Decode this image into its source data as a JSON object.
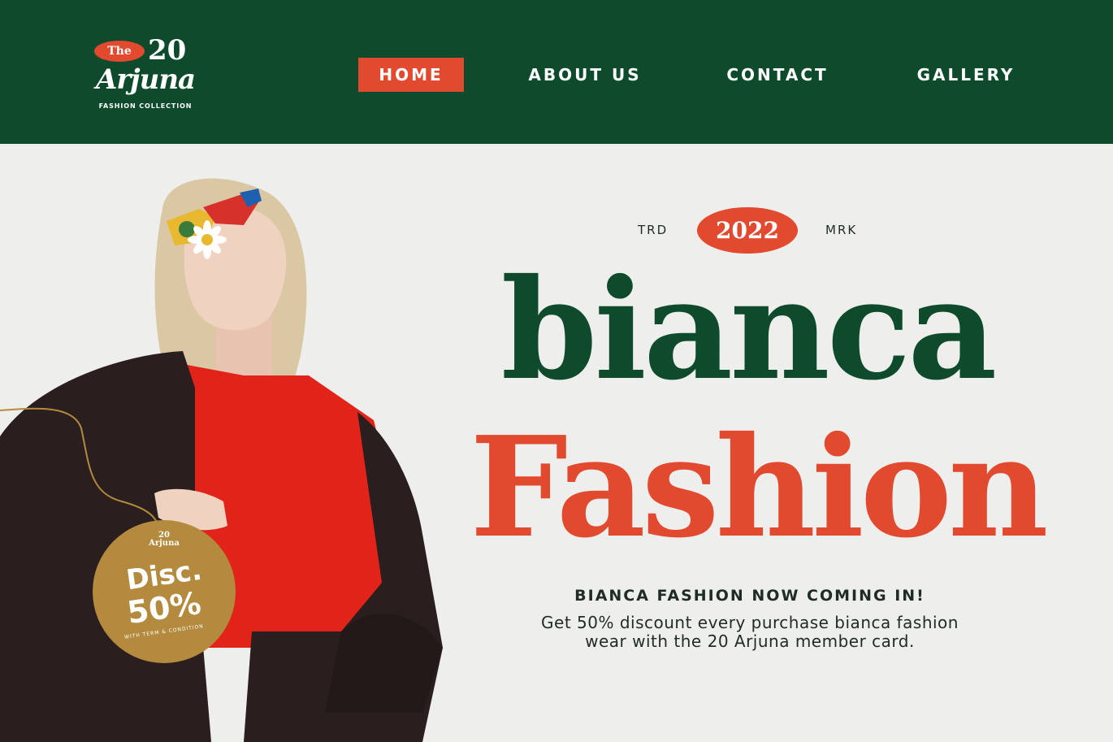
{
  "header": {
    "logo": {
      "prefix": "The",
      "number": "20",
      "name": "Arjuna",
      "subtitle": "FASHION COLLECTION"
    },
    "nav": [
      {
        "label": "HOME",
        "active": true
      },
      {
        "label": "ABOUT US",
        "active": false
      },
      {
        "label": "CONTACT",
        "active": false
      },
      {
        "label": "GALLERY",
        "active": false
      }
    ]
  },
  "hero": {
    "left_tag": "TRD",
    "year": "2022",
    "right_tag": "MRK",
    "title_line1": "bianca",
    "title_line2": "Fashion",
    "tagline": "BIANCA FASHION NOW COMING IN!",
    "description_line1": "Get 50% discount every purchase bianca fashion",
    "description_line2": "wear with the 20 Arjuna member card."
  },
  "badge": {
    "logo_number": "20",
    "logo_name": "Arjuna",
    "label": "Disc.",
    "value": "50%",
    "note": "WITH TERM & CONDITION"
  },
  "colors": {
    "header_bg": "#0e4a2c",
    "accent": "#e14a2e",
    "background": "#eeeeec",
    "badge": "#b38a3e"
  }
}
